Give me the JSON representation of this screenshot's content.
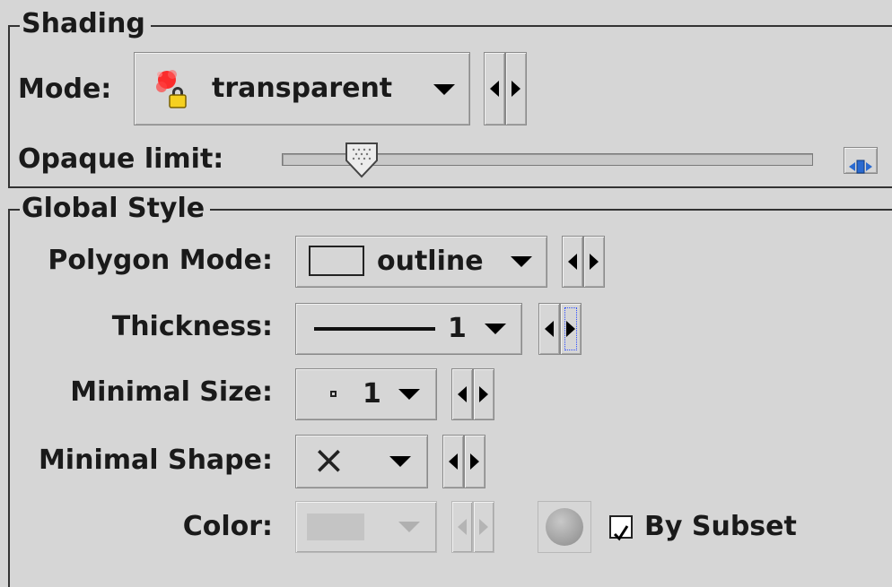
{
  "shading": {
    "title": "Shading",
    "mode_label": "Mode:",
    "mode_value": "transparent",
    "opaque_label": "Opaque limit:",
    "opaque_value_fraction": 0.15
  },
  "global_style": {
    "title": "Global Style",
    "polygon_mode_label": "Polygon Mode:",
    "polygon_mode_value": "outline",
    "thickness_label": "Thickness:",
    "thickness_value": "1",
    "minimal_size_label": "Minimal Size:",
    "minimal_size_value": "1",
    "minimal_shape_label": "Minimal Shape:",
    "minimal_shape_value": "×",
    "color_label": "Color:",
    "by_subset_label": "By Subset",
    "by_subset_checked": true
  },
  "colors": {
    "background": "#d6d6d6",
    "mode_icon_red": "#ff1a1a",
    "lock_yellow": "#f5d020",
    "reset_icon_blue": "#2a6ad0"
  }
}
